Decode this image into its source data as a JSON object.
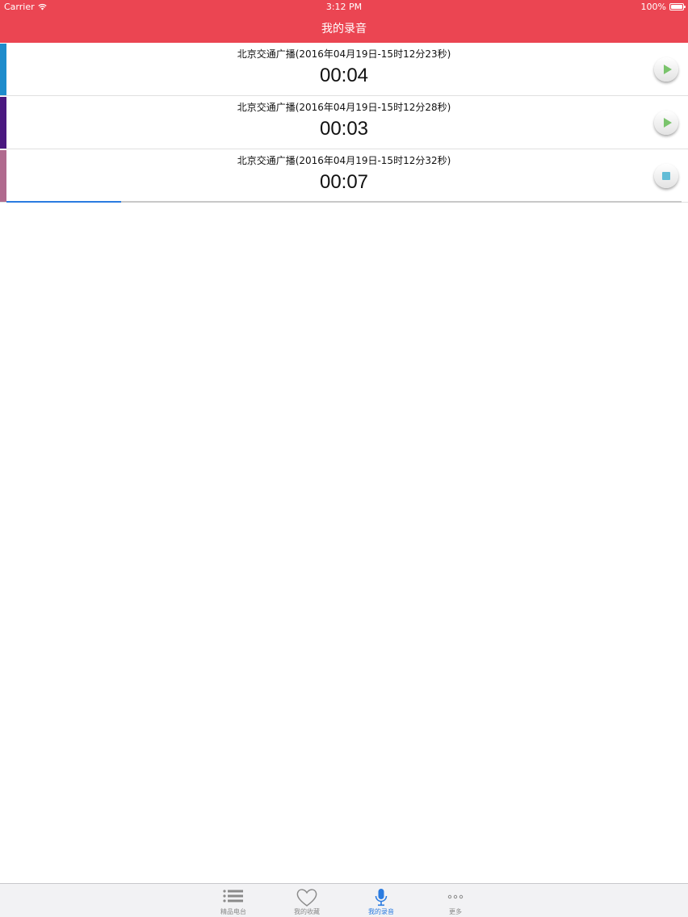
{
  "status_bar": {
    "carrier": "Carrier",
    "time": "3:12 PM",
    "battery": "100%"
  },
  "nav": {
    "title": "我的录音"
  },
  "recordings": [
    {
      "title": "北京交通广播(2016年04月19日-15时12分23秒)",
      "duration": "00:04",
      "color": "#1e8ccc",
      "action": "play-icon"
    },
    {
      "title": "北京交通广播(2016年04月19日-15时12分28秒)",
      "duration": "00:03",
      "color": "#4a1880",
      "action": "play-icon"
    },
    {
      "title": "北京交通广播(2016年04月19日-15时12分32秒)",
      "duration": "00:07",
      "color": "#b06a8e",
      "action": "stop-icon",
      "progress": 0.17
    }
  ],
  "tabs": [
    {
      "label": "精品电台",
      "icon": "list-icon",
      "active": false
    },
    {
      "label": "我的收藏",
      "icon": "heart-icon",
      "active": false
    },
    {
      "label": "我的录音",
      "icon": "microphone-icon",
      "active": true
    },
    {
      "label": "更多",
      "icon": "more-icon",
      "active": false
    }
  ],
  "colors": {
    "accent": "#eb4552",
    "active_tab": "#2a7be0",
    "inactive_tab": "#8a8a8a"
  }
}
